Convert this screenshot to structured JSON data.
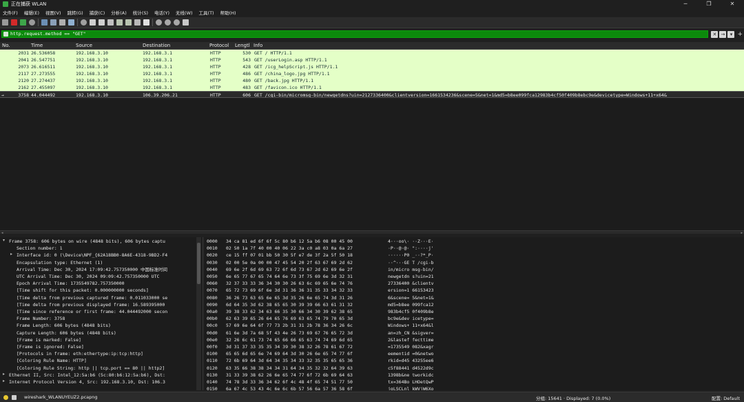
{
  "window": {
    "title": "正在捕获 WLAN",
    "minimize": "─",
    "maximize": "❐",
    "close": "✕"
  },
  "menu": [
    "文件(F)",
    "编辑(E)",
    "视图(V)",
    "跳转(G)",
    "捕获(C)",
    "分析(A)",
    "统计(S)",
    "电话(Y)",
    "无线(W)",
    "工具(T)",
    "帮助(H)"
  ],
  "filter": {
    "value": "http.request.method == \"GET\"",
    "clear": "✕",
    "apply": "→",
    "dropdown": "▾",
    "add": "+"
  },
  "columns": [
    "No.",
    "Time",
    "Source",
    "Destination",
    "Protocol",
    "Lengtl",
    "Info"
  ],
  "packets": [
    {
      "no": "2031",
      "time": "26.536058",
      "src": "192.168.3.10",
      "dst": "192.168.3.1",
      "proto": "HTTP",
      "len": "530",
      "info": "GET / HTTP/1.1",
      "style": "http"
    },
    {
      "no": "2041",
      "time": "26.547751",
      "src": "192.168.3.10",
      "dst": "192.168.3.1",
      "proto": "HTTP",
      "len": "543",
      "info": "GET /userLogin.asp HTTP/1.1",
      "style": "http"
    },
    {
      "no": "2073",
      "time": "26.616511",
      "src": "192.168.3.10",
      "dst": "192.168.3.1",
      "proto": "HTTP",
      "len": "428",
      "info": "GET /icg_helpScript.js HTTP/1.1",
      "style": "http"
    },
    {
      "no": "2117",
      "time": "27.273555",
      "src": "192.168.3.10",
      "dst": "192.168.3.1",
      "proto": "HTTP",
      "len": "486",
      "info": "GET /china_logo.jpg HTTP/1.1",
      "style": "http"
    },
    {
      "no": "2120",
      "time": "27.274437",
      "src": "192.168.3.10",
      "dst": "192.168.3.1",
      "proto": "HTTP",
      "len": "480",
      "info": "GET /back.jpg HTTP/1.1",
      "style": "http"
    },
    {
      "no": "2162",
      "time": "27.455097",
      "src": "192.168.3.10",
      "dst": "192.168.3.1",
      "proto": "HTTP",
      "len": "483",
      "info": "GET /favicon.ico HTTP/1.1",
      "style": "http"
    },
    {
      "no": "3758",
      "time": "44.044492",
      "src": "192.168.3.10",
      "dst": "106.39.206.21",
      "proto": "HTTP",
      "len": "606",
      "info": "GET /cgi-bin/micromsg-bin/newgetdns?uin=2127336400&clientversion=1661534236&scene=5&net=1&md5=b8ee099fca12983b4cf50f409b8ebc9e&devicetype=Windows+11+x64&",
      "style": "selected",
      "marker": "→"
    }
  ],
  "details": [
    {
      "text": "Frame 3758: 606 bytes on wire (4848 bits), 606 bytes captu",
      "indent": 0,
      "arrow": "▾"
    },
    {
      "text": "Section number: 1",
      "indent": 1,
      "arrow": ""
    },
    {
      "text": "Interface id: 0 (\\Device\\NPF_{62A18BB0-8A6E-4318-9BD2-F4",
      "indent": 1,
      "arrow": "▸"
    },
    {
      "text": "Encapsulation type: Ethernet (1)",
      "indent": 1,
      "arrow": ""
    },
    {
      "text": "Arrival Time: Dec 30, 2024 17:09:42.757350000 中国标准时间",
      "indent": 1,
      "arrow": ""
    },
    {
      "text": "UTC Arrival Time: Dec 30, 2024 09:09:42.757350000 UTC",
      "indent": 1,
      "arrow": ""
    },
    {
      "text": "Epoch Arrival Time: 1735549782.757350000",
      "indent": 1,
      "arrow": ""
    },
    {
      "text": "[Time shift for this packet: 0.000000000 seconds]",
      "indent": 1,
      "arrow": ""
    },
    {
      "text": "[Time delta from previous captured frame: 0.011033000 se",
      "indent": 1,
      "arrow": ""
    },
    {
      "text": "[Time delta from previous displayed frame: 16.589395000",
      "indent": 1,
      "arrow": ""
    },
    {
      "text": "[Time since reference or first frame: 44.044492000 secon",
      "indent": 1,
      "arrow": ""
    },
    {
      "text": "Frame Number: 3758",
      "indent": 1,
      "arrow": ""
    },
    {
      "text": "Frame Length: 606 bytes (4848 bits)",
      "indent": 1,
      "arrow": ""
    },
    {
      "text": "Capture Length: 606 bytes (4848 bits)",
      "indent": 1,
      "arrow": ""
    },
    {
      "text": "[Frame is marked: False]",
      "indent": 1,
      "arrow": ""
    },
    {
      "text": "[Frame is ignored: False]",
      "indent": 1,
      "arrow": ""
    },
    {
      "text": "[Protocols in frame: eth:ethertype:ip:tcp:http]",
      "indent": 1,
      "arrow": ""
    },
    {
      "text": "[Coloring Rule Name: HTTP]",
      "indent": 1,
      "arrow": ""
    },
    {
      "text": "[Coloring Rule String: http || tcp.port == 80 || http2]",
      "indent": 1,
      "arrow": ""
    },
    {
      "text": "Ethernet II, Src: Intel_12:5a:b6 (5c:80:b6:12:5a:b6), Dst:",
      "indent": 0,
      "arrow": "▸"
    },
    {
      "text": "Internet Protocol Version 4, Src: 192.168.3.10, Dst: 106.3",
      "indent": 0,
      "arrow": "▸"
    }
  ],
  "hex": [
    {
      "off": "0000",
      "bytes": "34 ca 81 ed 6f 6f 5c 80  b6 12 5a b6 08 00 45 00",
      "ascii": "4···oo\\·  ··Z···E·"
    },
    {
      "off": "0010",
      "bytes": "02 50 1a 7f 40 00 40 06  22 3a c0 a8 03 0a 6a 27",
      "ascii": "·P··@·@·  \":····j'"
    },
    {
      "off": "0020",
      "bytes": "ce 15 ff 07 01 bb 50 30  5f e7 de 3f 2a 5f 50 18",
      "ascii": "······P0  _··?*_P·"
    },
    {
      "off": "0030",
      "bytes": "02 00 5e 0a 00 00 47 45  54 20 2f 63 67 69 2d 62",
      "ascii": "··^···GE  T /cgi-b"
    },
    {
      "off": "0040",
      "bytes": "69 6e 2f 6d 69 63 72 6f  6d 73 67 2d 62 69 6e 2f",
      "ascii": "in/micro  msg-bin/"
    },
    {
      "off": "0050",
      "bytes": "6e 65 77 67 65 74 64 6e  73 3f 75 69 6e 3d 32 31",
      "ascii": "newgetdn  s?uin=21"
    },
    {
      "off": "0060",
      "bytes": "32 37 33 33 36 34 30 30  26 63 6c 69 65 6e 74 76",
      "ascii": "27336400  &clientv"
    },
    {
      "off": "0070",
      "bytes": "65 72 73 69 6f 6e 3d 31  36 36 31 35 33 34 32 33",
      "ascii": "ersion=1  66153423"
    },
    {
      "off": "0080",
      "bytes": "36 26 73 63 65 6e 65 3d  35 26 6e 65 74 3d 31 26",
      "ascii": "6&scene=  5&net=1&"
    },
    {
      "off": "0090",
      "bytes": "6d 64 35 3d 62 38 65 65  30 39 39 66 63 61 31 32",
      "ascii": "md5=b8ee  099fca12"
    },
    {
      "off": "00a0",
      "bytes": "39 38 33 62 34 63 66 35  30 66 34 30 39 62 38 65",
      "ascii": "983b4cf5  0f409b8e"
    },
    {
      "off": "00b0",
      "bytes": "62 63 39 65 26 64 65 76  69 63 65 74 79 70 65 3d",
      "ascii": "bc9e&dev  icetype="
    },
    {
      "off": "00c0",
      "bytes": "57 69 6e 64 6f 77 73 2b  31 31 2b 78 36 34 26 6c",
      "ascii": "Windows+  11+x64&l"
    },
    {
      "off": "00d0",
      "bytes": "61 6e 3d 7a 68 5f 43 4e  26 73 69 67 76 65 72 3d",
      "ascii": "an=zh_CN  &sigver="
    },
    {
      "off": "00e0",
      "bytes": "32 26 6c 61 73 74 65 66  66 65 63 74 74 69 6d 65",
      "ascii": "2&lastef  fecttime"
    },
    {
      "off": "00f0",
      "bytes": "3d 31 37 33 35 35 34 39  30 38 32 26 78 61 67 72",
      "ascii": "=1735549  082&xagr"
    },
    {
      "off": "0100",
      "bytes": "65 65 6d 65 6e 74 69 64  3d 30 26 6e 65 74 77 6f",
      "ascii": "eementid  =0&netwo"
    },
    {
      "off": "0110",
      "bytes": "72 6b 69 64 3d 64 34 35  34 33 32 35 35 65 65 36",
      "ascii": "rkid=d45  43255ee6"
    },
    {
      "off": "0120",
      "bytes": "63 35 66 38 38 34 34 31  64 34 35 32 32 64 39 63",
      "ascii": "c5f88441  d4522d9c"
    },
    {
      "off": "0130",
      "bytes": "31 33 39 38 62 26 6e 65  74 77 6f 72 6b 69 64 63",
      "ascii": "1398b&ne  tworkidc"
    },
    {
      "off": "0140",
      "bytes": "74 78 3d 33 36 34 62 6f  4c 48 4f 65 74 51 77 50",
      "ascii": "tx=364Bo  LHOetQwP"
    },
    {
      "off": "0150",
      "bytes": "6a 67 4c 53 43 4c 6e 6c  6b 57 56 6a 57 36 58 6f",
      "ascii": "jgLSCLnl  kWVjW6Xo"
    }
  ],
  "status": {
    "file": "wireshark_WLANUYEUZ2.pcapng",
    "counts": "分组: 15641 · Displayed: 7 (0.0%)",
    "profile": "配置: Default"
  },
  "colors": {
    "http_row": "#e4ffc7",
    "filter_ok": "#0c8a0c"
  }
}
